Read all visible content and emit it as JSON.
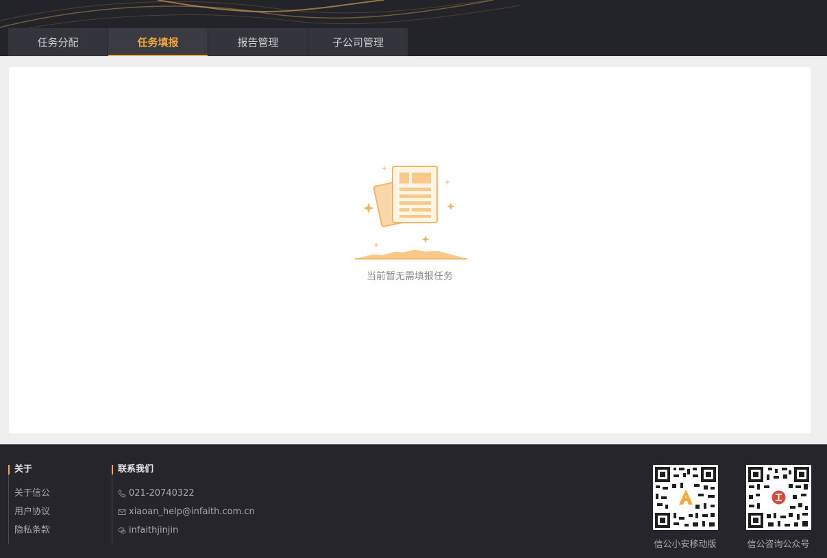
{
  "header": {
    "tabs": [
      {
        "label": "任务分配",
        "active": false
      },
      {
        "label": "任务填报",
        "active": true
      },
      {
        "label": "报告管理",
        "active": false
      },
      {
        "label": "子公司管理",
        "active": false
      }
    ]
  },
  "main": {
    "empty_text": "当前暂无需填报任务",
    "empty_icon": "document-empty-icon"
  },
  "footer": {
    "about": {
      "title": "关于",
      "links": [
        "关于信公",
        "用户协议",
        "隐私条款"
      ]
    },
    "contact": {
      "title": "联系我们",
      "phone": "021-20740322",
      "email": "xiaoan_help@infaith.com.cn",
      "wechat": "infaithjinjin"
    },
    "qr_codes": [
      {
        "label": "信公小安移动版"
      },
      {
        "label": "信公咨询公众号"
      }
    ]
  },
  "colors": {
    "accent": "#f5a93a",
    "header_bg": "#23232a",
    "footer_bg": "#25252b",
    "page_bg": "#efeff0"
  }
}
